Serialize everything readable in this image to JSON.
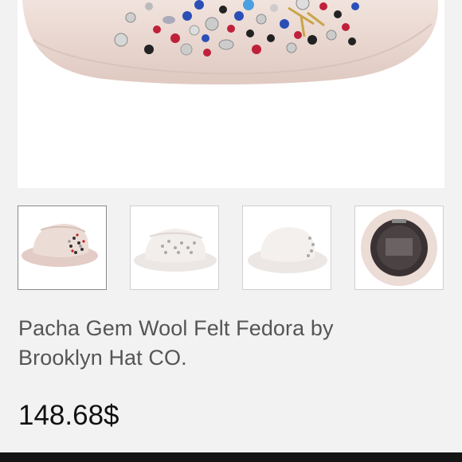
{
  "product": {
    "title_line1": "Pacha Gem Wool Felt Fedora by",
    "title_line2": "Brooklyn Hat CO.",
    "price": "148.68$"
  },
  "gallery": {
    "main_image": "jeweled-fedora-hat",
    "thumbnails": [
      {
        "image": "fedora-side-view-with-gems",
        "selected": true
      },
      {
        "image": "fedora-front-with-gems",
        "selected": false
      },
      {
        "image": "fedora-other-side-with-gems",
        "selected": false
      },
      {
        "image": "fedora-interior-view",
        "selected": false
      }
    ]
  },
  "colors": {
    "hat": "#ecdcd6",
    "text": "#555555",
    "price": "#111111",
    "background": "#f2f2f2"
  }
}
